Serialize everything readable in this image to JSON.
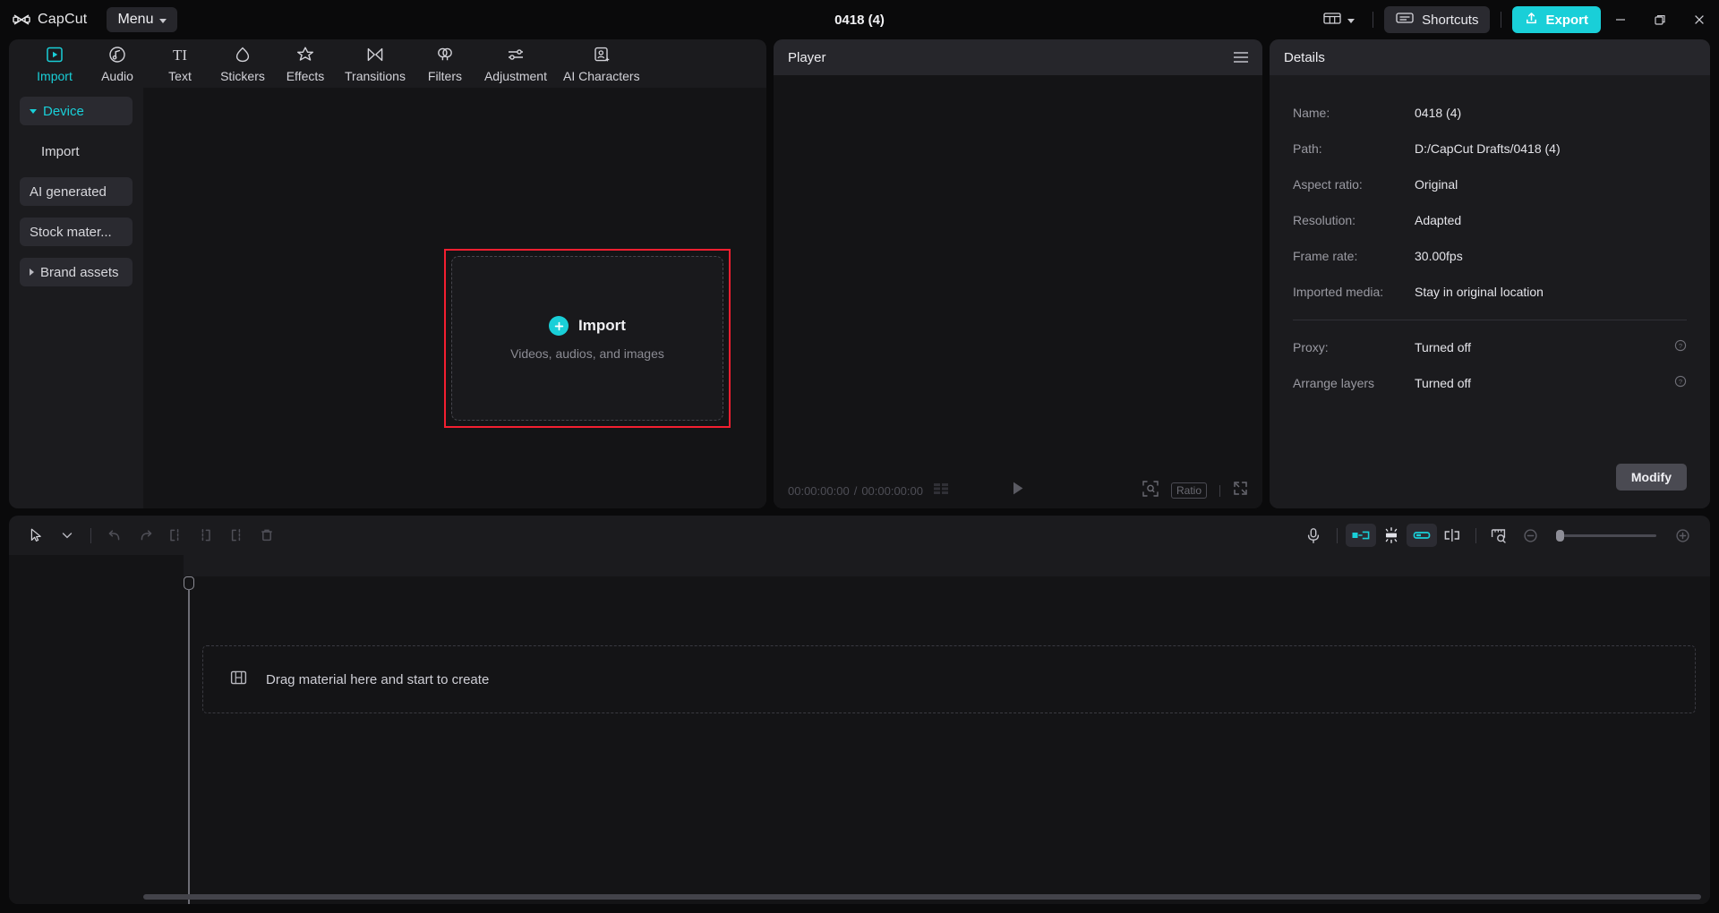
{
  "titlebar": {
    "brand_name": "CapCut",
    "brand_icon": "capcut-logo-icon",
    "menu_label": "Menu",
    "document_title": "0418 (4)",
    "layout_icon": "layout-panels-icon",
    "layout_caret_icon": "chevron-down-icon",
    "shortcuts_label": "Shortcuts",
    "shortcuts_icon": "keyboard-icon",
    "export_label": "Export",
    "export_icon": "upload-icon",
    "export_color": "#19cfd8",
    "minimize_icon": "minimize-icon",
    "maximize_icon": "restore-icon",
    "close_icon": "close-icon"
  },
  "nav_tabs": [
    {
      "label": "Import",
      "icon": "import-play-icon",
      "active": true
    },
    {
      "label": "Audio",
      "icon": "audio-note-icon",
      "active": false
    },
    {
      "label": "Text",
      "icon": "text-ti-icon",
      "active": false
    },
    {
      "label": "Stickers",
      "icon": "sticker-icon",
      "active": false
    },
    {
      "label": "Effects",
      "icon": "effects-star-icon",
      "active": false
    },
    {
      "label": "Transitions",
      "icon": "transitions-icon",
      "active": false
    },
    {
      "label": "Filters",
      "icon": "filters-icon",
      "active": false
    },
    {
      "label": "Adjustment",
      "icon": "adjustment-icon",
      "active": false
    },
    {
      "label": "AI Characters",
      "icon": "ai-character-icon",
      "active": false
    }
  ],
  "sidebar": {
    "items": [
      {
        "label": "Device",
        "style": "boxed",
        "arrow": "down",
        "active": true
      },
      {
        "label": "Import",
        "style": "plain",
        "arrow": "none",
        "active": false
      },
      {
        "label": "AI generated",
        "style": "boxed",
        "arrow": "none",
        "active": false
      },
      {
        "label": "Stock mater...",
        "style": "boxed",
        "arrow": "none",
        "active": false
      },
      {
        "label": "Brand assets",
        "style": "boxed",
        "arrow": "right",
        "active": false
      }
    ]
  },
  "dropzone": {
    "title": "Import",
    "subtitle": "Videos, audios, and images",
    "plus_icon": "plus-circle-icon",
    "highlight_color": "#f31f30"
  },
  "player": {
    "title": "Player",
    "menu_icon": "hamburger-menu-icon",
    "current_time": "00:00:00:00",
    "separator": "/",
    "total_time": "00:00:00:00",
    "frames_icon": "frames-grid-icon",
    "play_icon": "play-icon",
    "zoom_icon": "magnifier-focus-icon",
    "ratio_label": "Ratio",
    "fullscreen_icon": "fullscreen-icon"
  },
  "details": {
    "title": "Details",
    "rows": [
      {
        "key": "Name:",
        "value": "0418 (4)",
        "help": false
      },
      {
        "key": "Path:",
        "value": "D:/CapCut Drafts/0418 (4)",
        "help": false
      },
      {
        "key": "Aspect ratio:",
        "value": "Original",
        "help": false
      },
      {
        "key": "Resolution:",
        "value": "Adapted",
        "help": false
      },
      {
        "key": "Frame rate:",
        "value": "30.00fps",
        "help": false
      },
      {
        "key": "Imported media:",
        "value": "Stay in original location",
        "help": false
      }
    ],
    "rows2": [
      {
        "key": "Proxy:",
        "value": "Turned off",
        "help": true
      },
      {
        "key": "Arrange layers",
        "value": "Turned off",
        "help": true
      }
    ],
    "help_icon": "question-circle-icon",
    "modify_label": "Modify"
  },
  "timeline": {
    "tools_left": [
      {
        "icon": "select-cursor-icon",
        "type": "btn"
      },
      {
        "icon": "chevron-down-icon",
        "type": "btn"
      },
      {
        "icon": "separator",
        "type": "sep"
      },
      {
        "icon": "undo-icon",
        "type": "btn"
      },
      {
        "icon": "redo-icon",
        "type": "btn"
      },
      {
        "icon": "split-icon",
        "type": "btn"
      },
      {
        "icon": "trim-left-icon",
        "type": "btn"
      },
      {
        "icon": "trim-right-icon",
        "type": "btn"
      },
      {
        "icon": "delete-trash-icon",
        "type": "btn"
      }
    ],
    "tools_right": [
      {
        "icon": "microphone-icon",
        "type": "btn",
        "on": false
      },
      {
        "icon": "separator",
        "type": "sep",
        "on": false
      },
      {
        "icon": "auto-caption-icon",
        "type": "chip",
        "on": true
      },
      {
        "icon": "keyframe-icon",
        "type": "chip",
        "on": false
      },
      {
        "icon": "link-clip-icon",
        "type": "chip",
        "on": true
      },
      {
        "icon": "mirror-split-icon",
        "type": "chip",
        "on": false
      },
      {
        "icon": "separator",
        "type": "sep",
        "on": false
      },
      {
        "icon": "ruler-preview-icon",
        "type": "btn",
        "on": false
      }
    ],
    "zoom_out_icon": "zoom-out-icon",
    "zoom_in_icon": "zoom-in-icon",
    "drop_hint": "Drag material here and start to create",
    "drop_icon": "filmstrip-icon",
    "playhead_icon": "playhead-icon",
    "hscrollbar_icon": "horizontal-scrollbar"
  }
}
